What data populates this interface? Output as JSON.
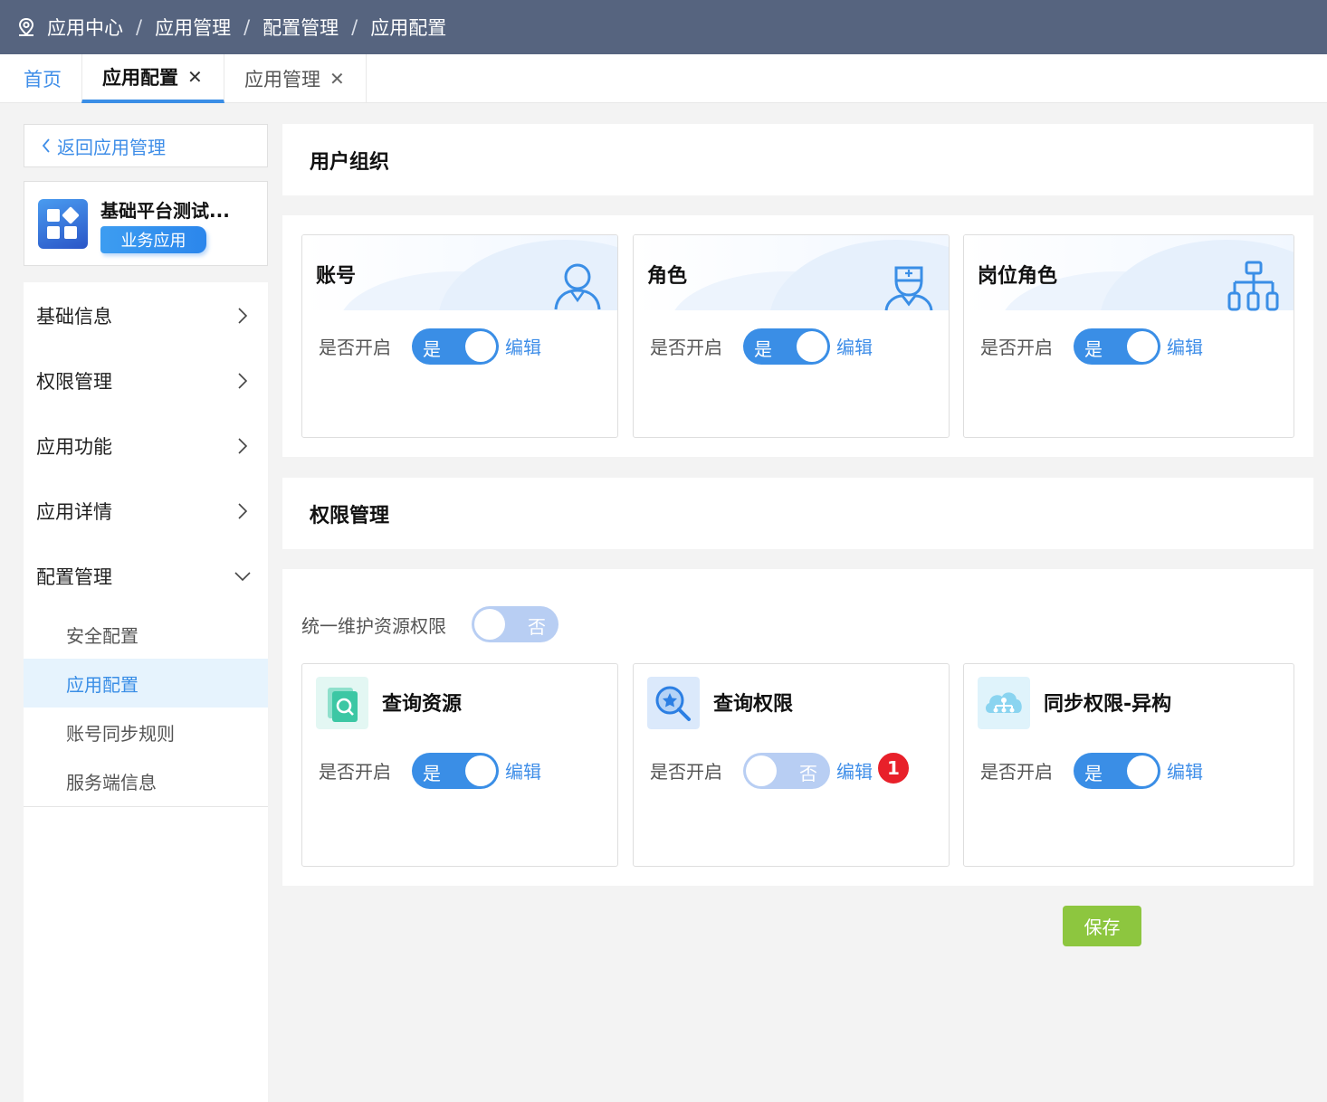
{
  "breadcrumb": [
    "应用中心",
    "应用管理",
    "配置管理",
    "应用配置"
  ],
  "breadcrumb_sep": "/",
  "tabs": {
    "home": "首页",
    "active": "应用配置",
    "mgmt": "应用管理",
    "close": "✕"
  },
  "sidebar": {
    "back": "返回应用管理",
    "app_name": "基础平台测试...",
    "app_badge": "业务应用",
    "menu": [
      "基础信息",
      "权限管理",
      "应用功能",
      "应用详情",
      "配置管理"
    ],
    "submenu": [
      "安全配置",
      "应用配置",
      "账号同步规则",
      "服务端信息"
    ],
    "active_sub": "应用配置"
  },
  "user_org": {
    "title": "用户组织",
    "cards": [
      {
        "title": "账号",
        "label": "是否开启",
        "toggle": "是",
        "on": true,
        "edit": "编辑",
        "icon": "user-icon"
      },
      {
        "title": "角色",
        "label": "是否开启",
        "toggle": "是",
        "on": true,
        "edit": "编辑",
        "icon": "nurse-icon"
      },
      {
        "title": "岗位角色",
        "label": "是否开启",
        "toggle": "是",
        "on": true,
        "edit": "编辑",
        "icon": "org-chart-icon"
      }
    ]
  },
  "perm": {
    "title": "权限管理",
    "unified_label": "统一维护资源权限",
    "unified_toggle": "否",
    "cards": [
      {
        "title": "查询资源",
        "label": "是否开启",
        "toggle": "是",
        "on": true,
        "edit": "编辑",
        "icon": "search-resource-icon"
      },
      {
        "title": "查询权限",
        "label": "是否开启",
        "toggle": "否",
        "on": false,
        "edit": "编辑",
        "icon": "search-permission-icon",
        "badge": "1"
      },
      {
        "title": "同步权限-异构",
        "label": "是否开启",
        "toggle": "是",
        "on": true,
        "edit": "编辑",
        "icon": "cloud-sync-icon"
      }
    ]
  },
  "save_label": "保存",
  "colors": {
    "primary": "#3a8ee6",
    "header": "#56647f",
    "save": "#8dc63f",
    "badge": "#e8202a"
  }
}
